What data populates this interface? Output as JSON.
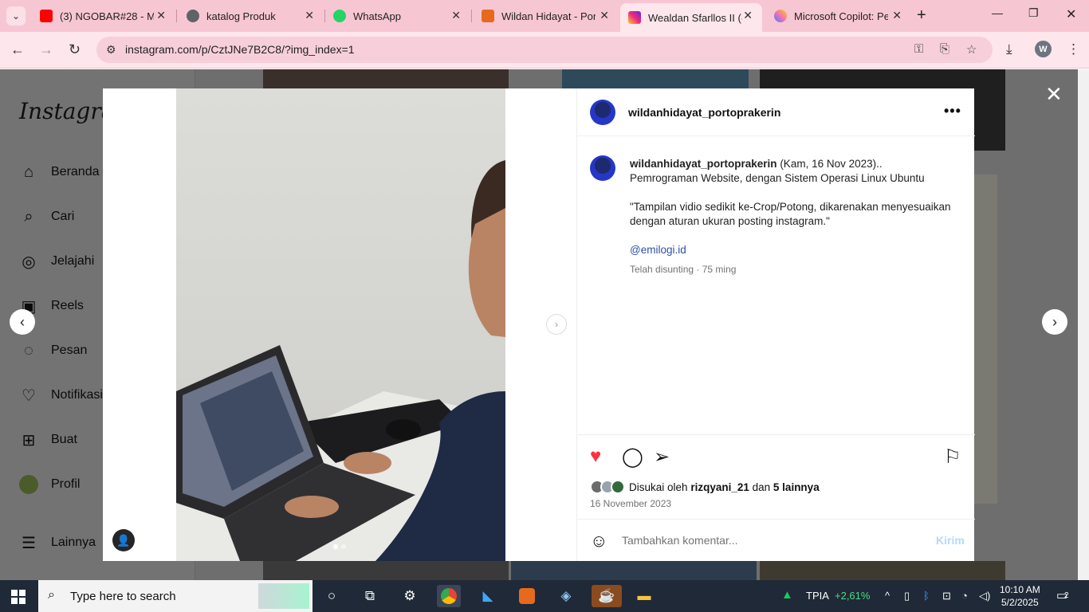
{
  "browser": {
    "tabs": [
      {
        "title": "(3) NGOBAR#28 - Me",
        "favicon_color": "#ff0000",
        "favicon": "youtube-icon"
      },
      {
        "title": "katalog Produk",
        "favicon_color": "#5f6368",
        "favicon": "globe-icon"
      },
      {
        "title": "WhatsApp",
        "favicon_color": "#25d366",
        "favicon": "whatsapp-icon"
      },
      {
        "title": "Wildan Hidayat - Port",
        "favicon_color": "#e66a1e",
        "favicon": "xampp-icon"
      },
      {
        "title": "Wealdan Sfarllos II (@",
        "favicon_color": "#d62976",
        "favicon": "instagram-icon",
        "active": true
      },
      {
        "title": "Microsoft Copilot: Pe",
        "favicon_color": "#3b82f6",
        "favicon": "copilot-icon"
      }
    ],
    "url": "instagram.com/p/CztJNe7B2C8/?img_index=1",
    "profile_initial": "W"
  },
  "sidebar": {
    "logo": "Instagram",
    "items": [
      {
        "label": "Beranda",
        "icon": "home-icon"
      },
      {
        "label": "Cari",
        "icon": "search-icon"
      },
      {
        "label": "Jelajahi",
        "icon": "compass-icon"
      },
      {
        "label": "Reels",
        "icon": "reels-icon"
      },
      {
        "label": "Pesan",
        "icon": "messenger-icon"
      },
      {
        "label": "Notifikasi",
        "icon": "heart-icon"
      },
      {
        "label": "Buat",
        "icon": "plus-square-icon"
      },
      {
        "label": "Profil",
        "icon": "profile-avatar"
      },
      {
        "label": "Lainnya",
        "icon": "menu-icon"
      }
    ]
  },
  "post": {
    "username": "wildanhidayat_portoprakerin",
    "caption_line1": "(Kam, 16 Nov 2023)..",
    "caption_line2": "Pemrograman Website, dengan Sistem Operasi Linux Ubuntu",
    "caption_quote": "\"Tampilan vidio sedikit ke-Crop/Potong, dikarenakan menyesuaikan dengan aturan ukuran posting instagram.\"",
    "mention": "@emilogi.id",
    "edited": "Telah disunting · 75 ming",
    "likes_prefix": "Disukai oleh",
    "likes_user": "rizqyani_21",
    "likes_and": "dan",
    "likes_others": "5 lainnya",
    "date": "16 November 2023",
    "comment_placeholder": "Tambahkan komentar...",
    "send_label": "Kirim",
    "liked": true,
    "carousel_index": 1,
    "carousel_count": 2
  },
  "taskbar": {
    "search_placeholder": "Type here to search",
    "stock_name": "TPIA",
    "stock_change": "+2,61%",
    "time": "10:10 AM",
    "date": "5/2/2025",
    "notification_count": "2"
  }
}
